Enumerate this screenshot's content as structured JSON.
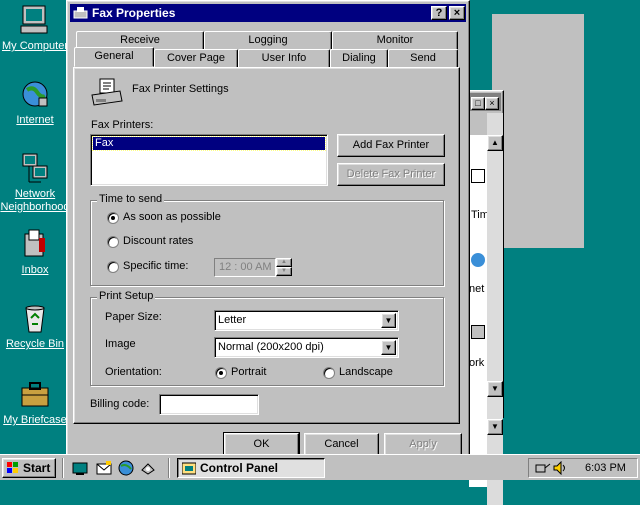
{
  "desktop": {
    "icons": [
      {
        "label": "My Computer",
        "icon": "computer-icon"
      },
      {
        "label": "Internet",
        "icon": "internet-icon"
      },
      {
        "label": "Network Neighborhood",
        "icon": "network-icon"
      },
      {
        "label": "Inbox",
        "icon": "inbox-icon"
      },
      {
        "label": "Recycle Bin",
        "icon": "recycle-bin-icon"
      },
      {
        "label": "My Briefcase",
        "icon": "briefcase-icon"
      }
    ]
  },
  "background_window": {
    "fragments": [
      "Tim",
      "net",
      "ork"
    ]
  },
  "dialog": {
    "title": "Fax Properties",
    "help_button": "?",
    "close_button": "×",
    "tabs_row1": [
      "Receive",
      "Logging",
      "Monitor"
    ],
    "tabs_row2": [
      "General",
      "Cover Page",
      "User Info",
      "Dialing",
      "Send"
    ],
    "active_tab": "General",
    "general": {
      "section_heading": "Fax Printer Settings",
      "printers_label": "Fax Printers:",
      "printers": [
        "Fax"
      ],
      "add_printer_button": "Add Fax Printer",
      "delete_printer_button": "Delete Fax Printer",
      "time_to_send": {
        "title": "Time to send",
        "options": [
          "As soon as possible",
          "Discount rates",
          "Specific time:"
        ],
        "selected": 0,
        "time_value": "12 : 00 AM"
      },
      "print_setup": {
        "title": "Print Setup",
        "paper_size_label": "Paper Size:",
        "paper_size_value": "Letter",
        "image_label": "Image",
        "image_value": "Normal (200x200 dpi)",
        "orientation_label": "Orientation:",
        "orientation_options": [
          "Portrait",
          "Landscape"
        ],
        "orientation_selected": 0
      },
      "billing_label": "Billing code:",
      "billing_value": ""
    },
    "buttons": {
      "ok": "OK",
      "cancel": "Cancel",
      "apply": "Apply"
    }
  },
  "taskbar": {
    "start_label": "Start",
    "quick_launch": [
      "show-desktop-icon",
      "outlook-icon",
      "browser-icon",
      "channels-icon"
    ],
    "task_label": "Control Panel",
    "clock": "6:03 PM"
  },
  "colors": {
    "desktop": "#008080",
    "titlebar": "#000080",
    "face": "#c0c0c0",
    "selection": "#000080"
  }
}
